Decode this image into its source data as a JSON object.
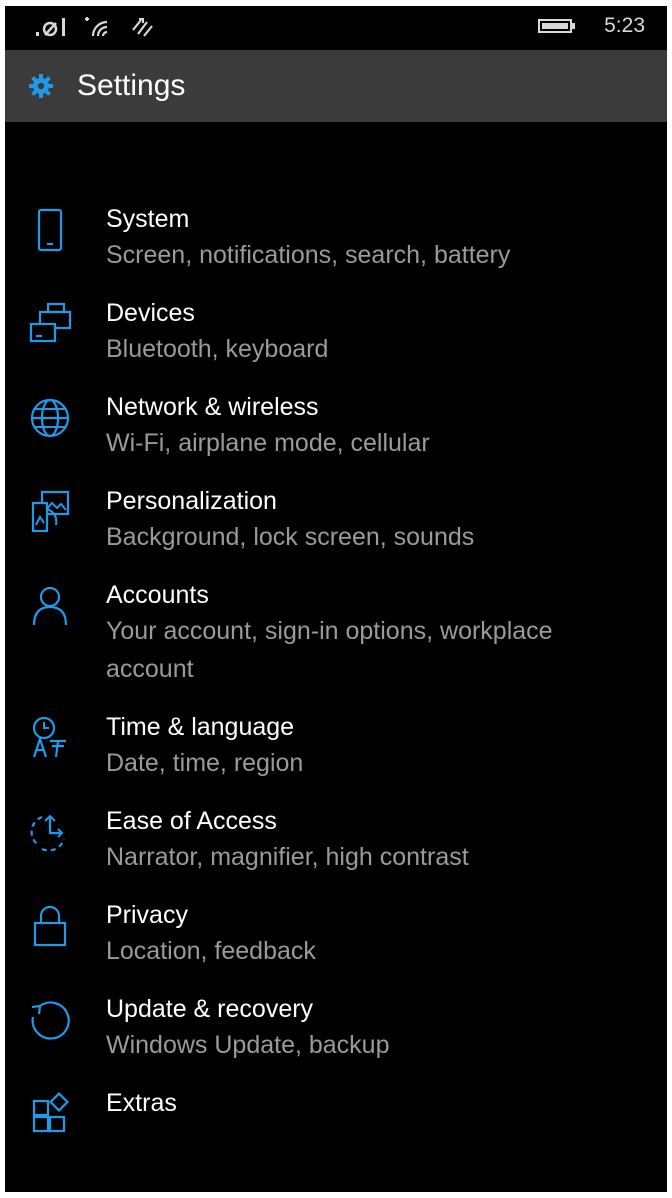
{
  "status_bar": {
    "time": "5:23"
  },
  "header": {
    "title": "Settings",
    "icon": "gear-icon"
  },
  "colors": {
    "accent": "#1e9ae8",
    "title_bar": "#3b3b3b",
    "background": "#000000",
    "secondary_text": "#9a9a9a"
  },
  "settings": [
    {
      "label": "System",
      "subtitle": "Screen, notifications, search, battery",
      "icon": "phone-icon"
    },
    {
      "label": "Devices",
      "subtitle": "Bluetooth, keyboard",
      "icon": "devices-icon"
    },
    {
      "label": "Network & wireless",
      "subtitle": "Wi-Fi, airplane mode, cellular",
      "icon": "globe-icon"
    },
    {
      "label": "Personalization",
      "subtitle": "Background, lock screen, sounds",
      "icon": "personalization-icon"
    },
    {
      "label": "Accounts",
      "subtitle": "Your account, sign-in options, workplace account",
      "icon": "person-icon"
    },
    {
      "label": "Time & language",
      "subtitle": "Date, time, region",
      "icon": "time-language-icon"
    },
    {
      "label": "Ease of Access",
      "subtitle": "Narrator, magnifier, high contrast",
      "icon": "ease-of-access-icon"
    },
    {
      "label": "Privacy",
      "subtitle": "Location, feedback",
      "icon": "lock-icon"
    },
    {
      "label": "Update & recovery",
      "subtitle": "Windows Update, backup",
      "icon": "update-icon"
    },
    {
      "label": "Extras",
      "subtitle": "",
      "icon": "extras-icon"
    }
  ]
}
